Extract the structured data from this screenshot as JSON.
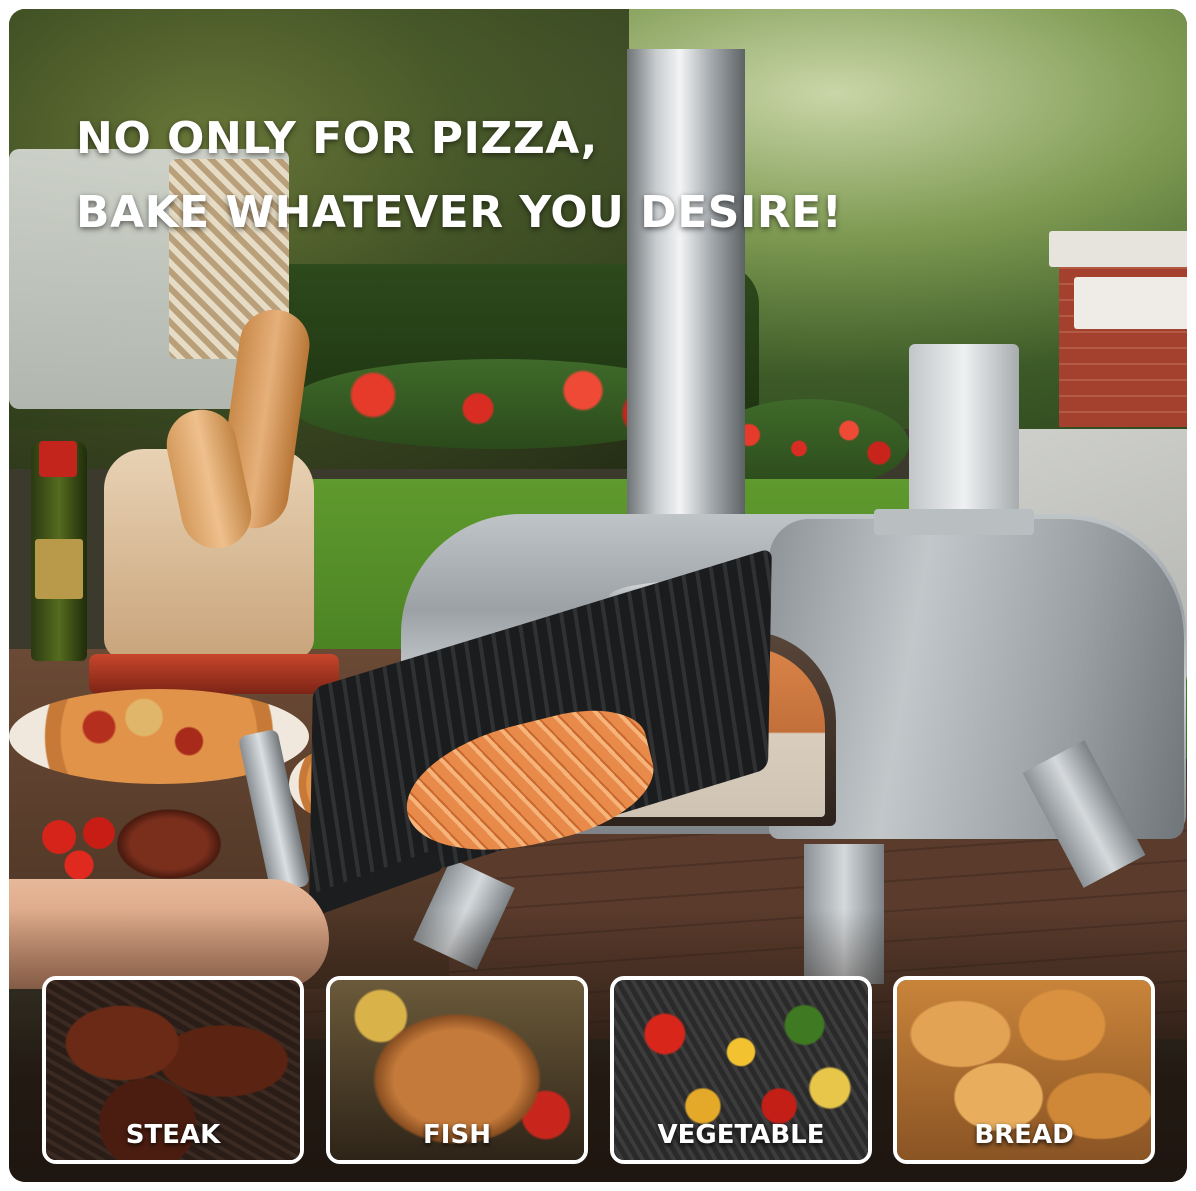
{
  "headline": {
    "line1": "NO ONLY FOR PIZZA,",
    "line2": "BAKE WHATEVER YOU DESIRE!"
  },
  "food_cards": [
    {
      "label": "STEAK"
    },
    {
      "label": "FISH"
    },
    {
      "label": "VEGETABLE"
    },
    {
      "label": "BREAD"
    }
  ],
  "colors": {
    "headline_text": "#ffffff",
    "card_border": "#ffffff",
    "card_label": "#ffffff",
    "oven_steel": "#c2c7ca"
  }
}
